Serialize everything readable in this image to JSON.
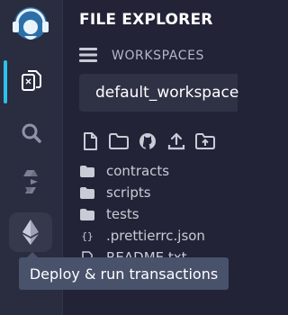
{
  "sidebar": {
    "icons": [
      {
        "name": "remix-logo"
      },
      {
        "name": "file-explorer-icon"
      },
      {
        "name": "search-icon"
      },
      {
        "name": "solidity-compiler-icon"
      },
      {
        "name": "deploy-run-icon"
      }
    ],
    "active_color": "#2fbfe9"
  },
  "panel": {
    "title": "FILE EXPLORER",
    "workspaces_label": "WORKSPACES",
    "workspace_selected": "default_workspace"
  },
  "toolbar": {
    "icons": [
      "new-file-icon",
      "new-folder-icon",
      "github-icon",
      "upload-file-icon",
      "upload-folder-icon"
    ]
  },
  "tree": {
    "items": [
      {
        "label": "contracts",
        "type": "folder"
      },
      {
        "label": "scripts",
        "type": "folder"
      },
      {
        "label": "tests",
        "type": "folder"
      },
      {
        "label": ".prettierrc.json",
        "type": "json"
      },
      {
        "label": "README.txt",
        "type": "file"
      }
    ]
  },
  "tooltip": {
    "text": "Deploy & run transactions"
  }
}
